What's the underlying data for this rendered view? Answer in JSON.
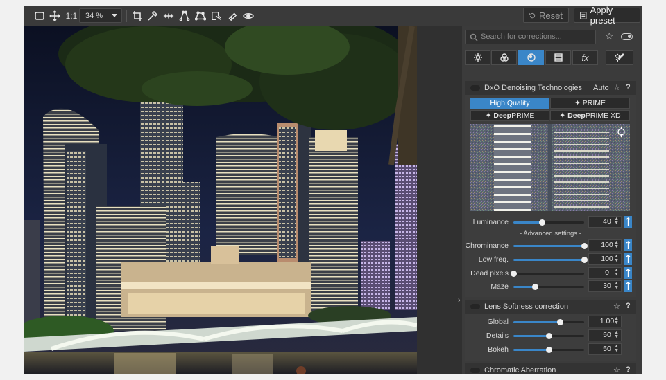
{
  "toolbar": {
    "zoom_ratio_label": "1:1",
    "zoom_value": "34 %",
    "reset_label": "Reset",
    "apply_preset_label": "Apply preset"
  },
  "panel": {
    "search_placeholder": "Search for corrections...",
    "tabs": [
      {
        "name": "tab-light",
        "icon": "sun-icon"
      },
      {
        "name": "tab-color",
        "icon": "color-circles-icon"
      },
      {
        "name": "tab-detail",
        "icon": "detail-icon",
        "active": true
      },
      {
        "name": "tab-geometry",
        "icon": "geometry-icon"
      },
      {
        "name": "tab-effects",
        "icon": "fx-icon",
        "label": "fx"
      },
      {
        "name": "tab-local",
        "icon": "brush-icon"
      }
    ],
    "denoise": {
      "title": "DxO Denoising Technologies",
      "auto": "Auto",
      "modes": {
        "high_quality": "High Quality",
        "prime": "PRIME",
        "deepprime_bold": "Deep",
        "deepprime_rest": "PRIME",
        "deepprimexd_bold": "Deep",
        "deepprimexd_rest": "PRIME XD"
      },
      "advanced_label": "- Advanced settings -",
      "sliders": [
        {
          "label": "Luminance",
          "value": "40",
          "level": 0.4
        },
        {
          "label": "Chrominance",
          "value": "100",
          "level": 1.0
        },
        {
          "label": "Low freq.",
          "value": "100",
          "level": 1.0
        },
        {
          "label": "Dead pixels",
          "value": "0",
          "level": 0.0
        },
        {
          "label": "Maze",
          "value": "30",
          "level": 0.3
        }
      ]
    },
    "lens": {
      "title": "Lens Softness correction",
      "sliders": [
        {
          "label": "Global",
          "value": "1.00",
          "level": 0.66
        },
        {
          "label": "Details",
          "value": "50",
          "level": 0.5
        },
        {
          "label": "Bokeh",
          "value": "50",
          "level": 0.5
        }
      ]
    },
    "chromatic": {
      "title": "Chromatic Aberration"
    }
  },
  "colors": {
    "accent": "#3a86c8",
    "panel_bg": "#3b3b3b",
    "toolbar_bg": "#3a3a3a"
  }
}
